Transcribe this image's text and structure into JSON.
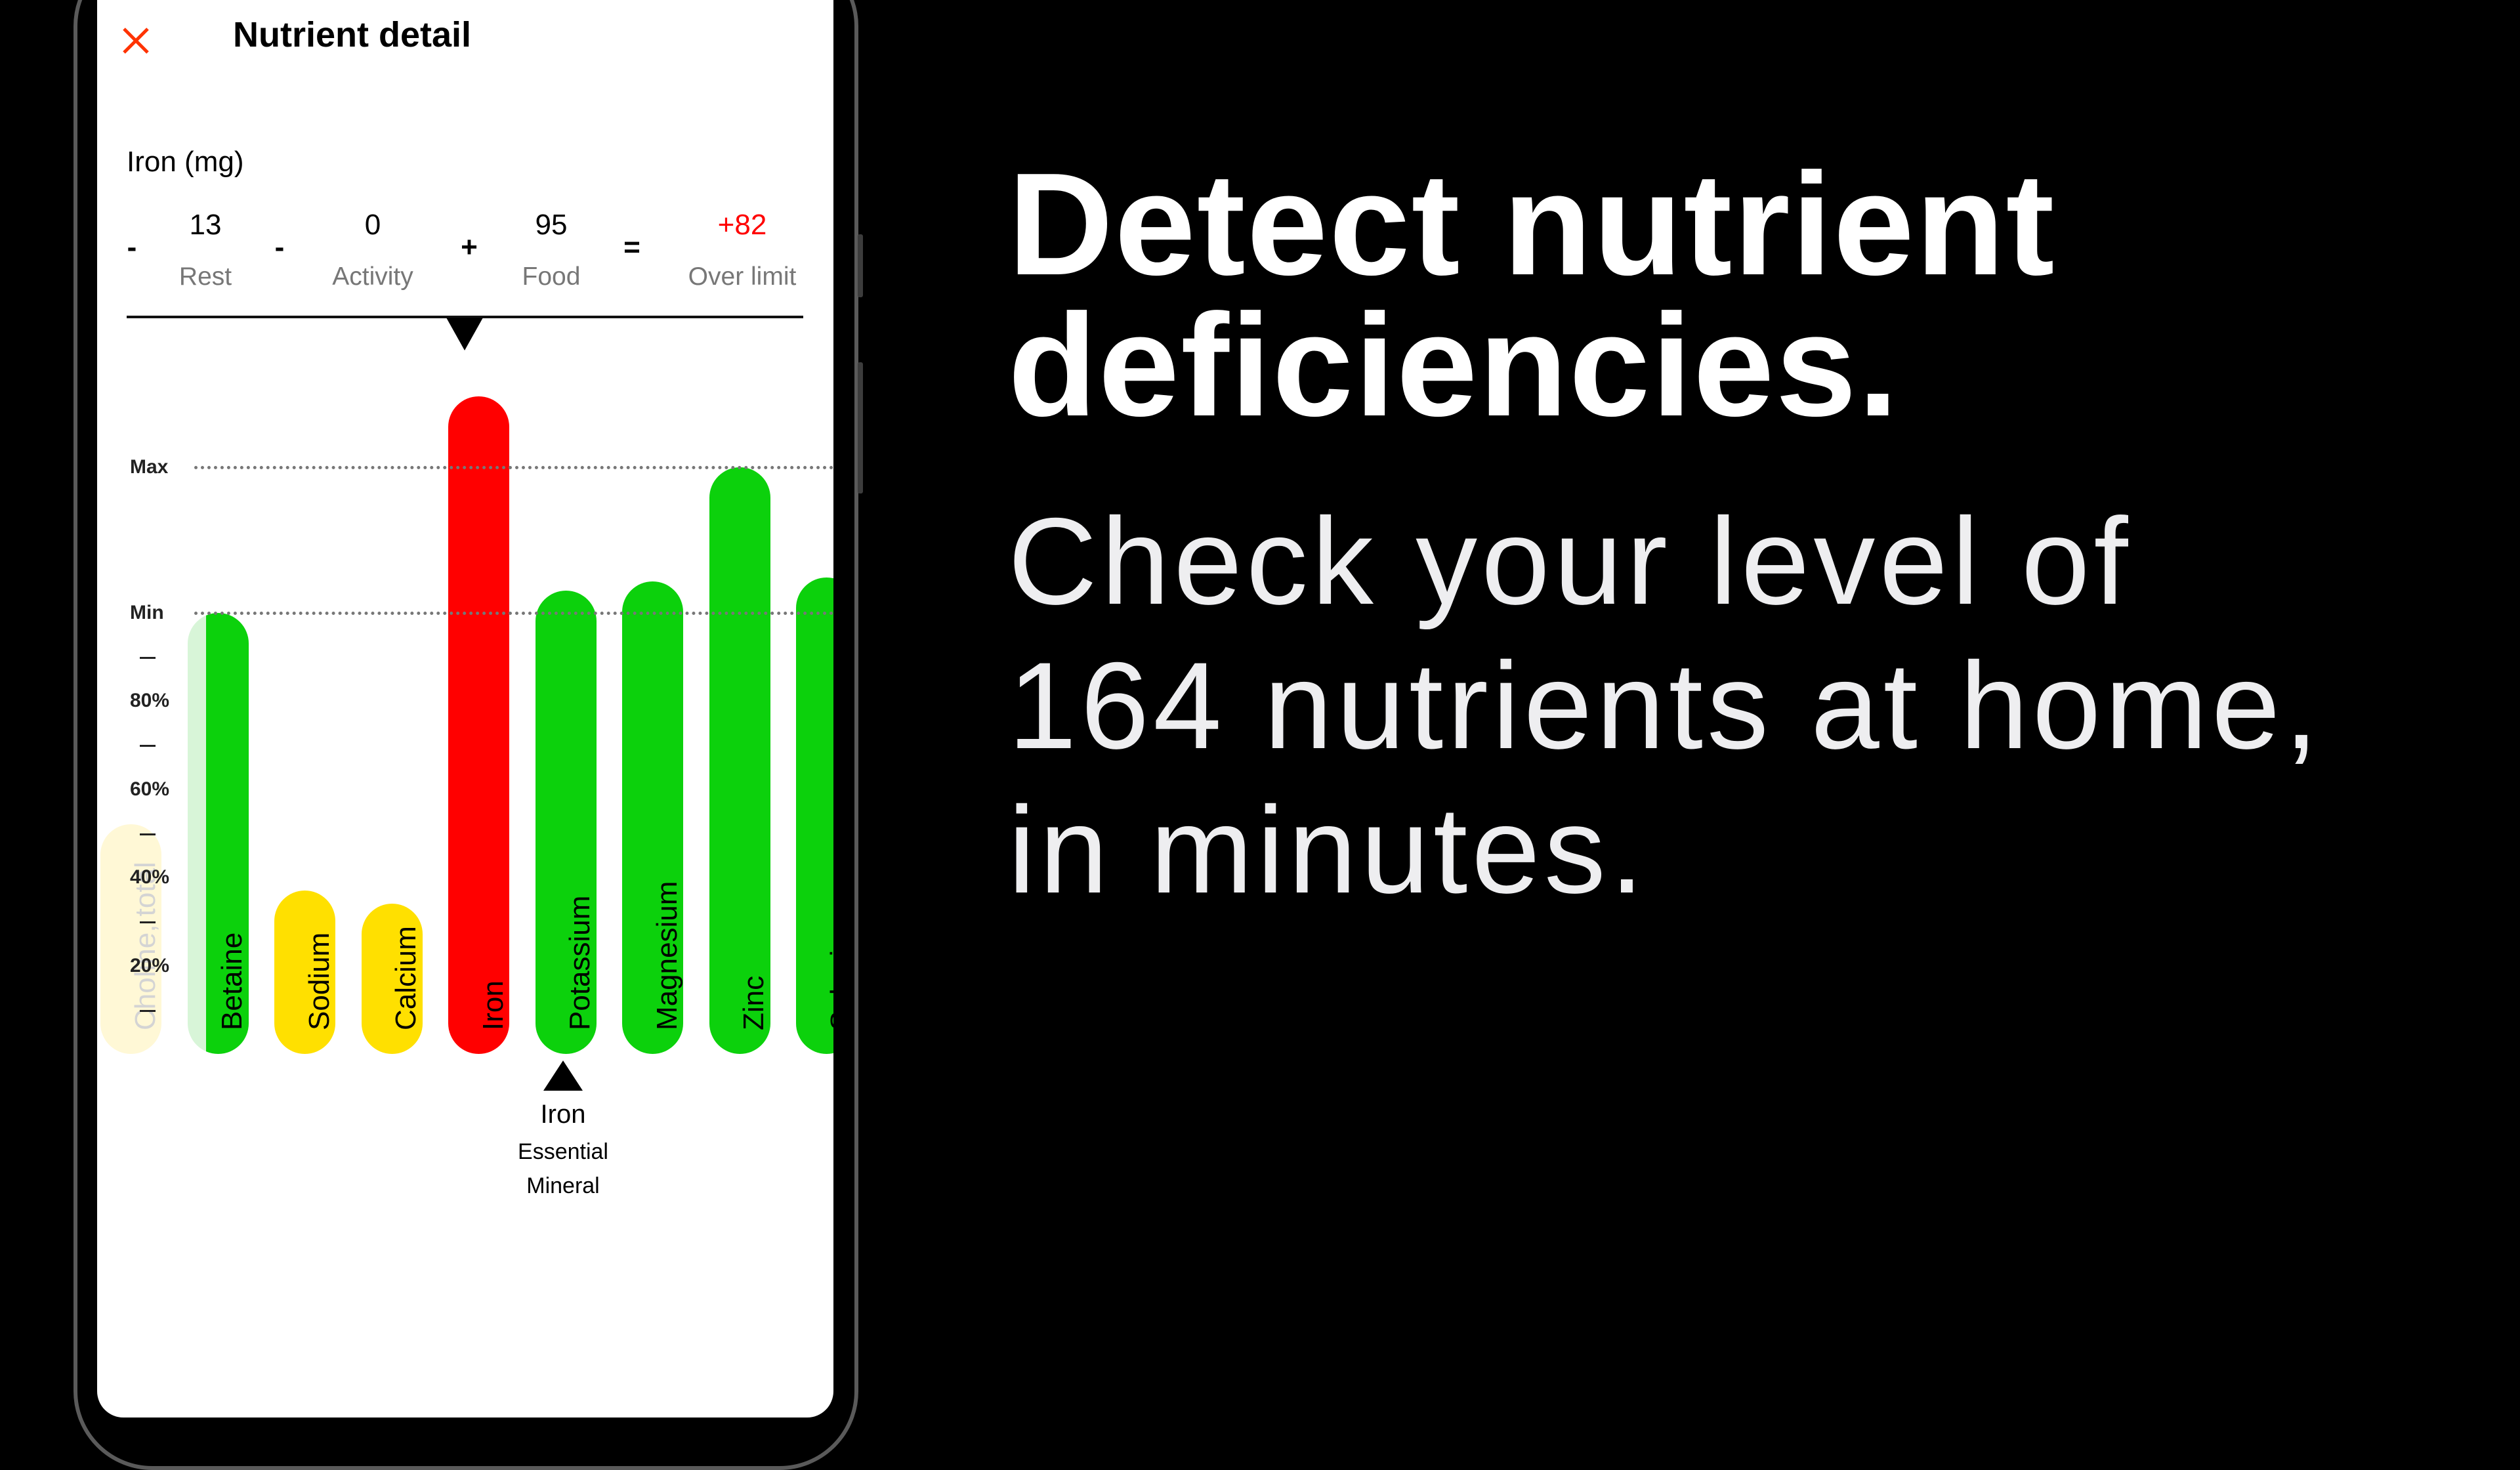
{
  "header": {
    "title": "Nutrient detail",
    "close_icon": "close-icon",
    "close_color": "#ff3300"
  },
  "nutrient": {
    "name": "Iron (mg)",
    "equation": {
      "operators": [
        "-",
        "-",
        "+",
        "="
      ],
      "terms": [
        {
          "value": "13",
          "label": "Rest"
        },
        {
          "value": "0",
          "label": "Activity"
        },
        {
          "value": "95",
          "label": "Food"
        },
        {
          "value": "+82",
          "label": "Over limit",
          "color": "#ff0000"
        }
      ]
    }
  },
  "selected": {
    "name": "Iron",
    "category_line1": "Essential",
    "category_line2": "Mineral"
  },
  "chart_data": {
    "type": "bar",
    "title": "",
    "xlabel": "",
    "ylabel": "",
    "ylim": [
      0,
      150
    ],
    "reference_lines": [
      {
        "label": "Max",
        "value": 133
      },
      {
        "label": "Min",
        "value": 100
      }
    ],
    "yticks": [
      {
        "label": "80%",
        "value": 80
      },
      {
        "label": "60%",
        "value": 60
      },
      {
        "label": "40%",
        "value": 40
      },
      {
        "label": "20%",
        "value": 20
      }
    ],
    "minor_ticks": [
      90,
      70,
      50,
      30,
      10
    ],
    "categories": [
      "Choline, total",
      "Betaine",
      "Sodium",
      "Calcium",
      "Iron",
      "Potassium",
      "Magnesium",
      "Zinc",
      "Selenium"
    ],
    "values": [
      52,
      100,
      37,
      34,
      149,
      105,
      107,
      133,
      108
    ],
    "colors": [
      "#fff8d6",
      "#0cd10c",
      "#ffe000",
      "#ffe000",
      "#ff0000",
      "#0cd10c",
      "#0cd10c",
      "#0cd10c",
      "#0cd10c"
    ],
    "faded": [
      true,
      false,
      false,
      false,
      false,
      false,
      false,
      false,
      false
    ],
    "selected_index": 4
  },
  "promo": {
    "headline_line1": "Detect nutrient",
    "headline_line2": "deficiencies.",
    "sub_line1": "Check your level of",
    "sub_line2": "164 nutrients at home,",
    "sub_line3": "in minutes."
  }
}
